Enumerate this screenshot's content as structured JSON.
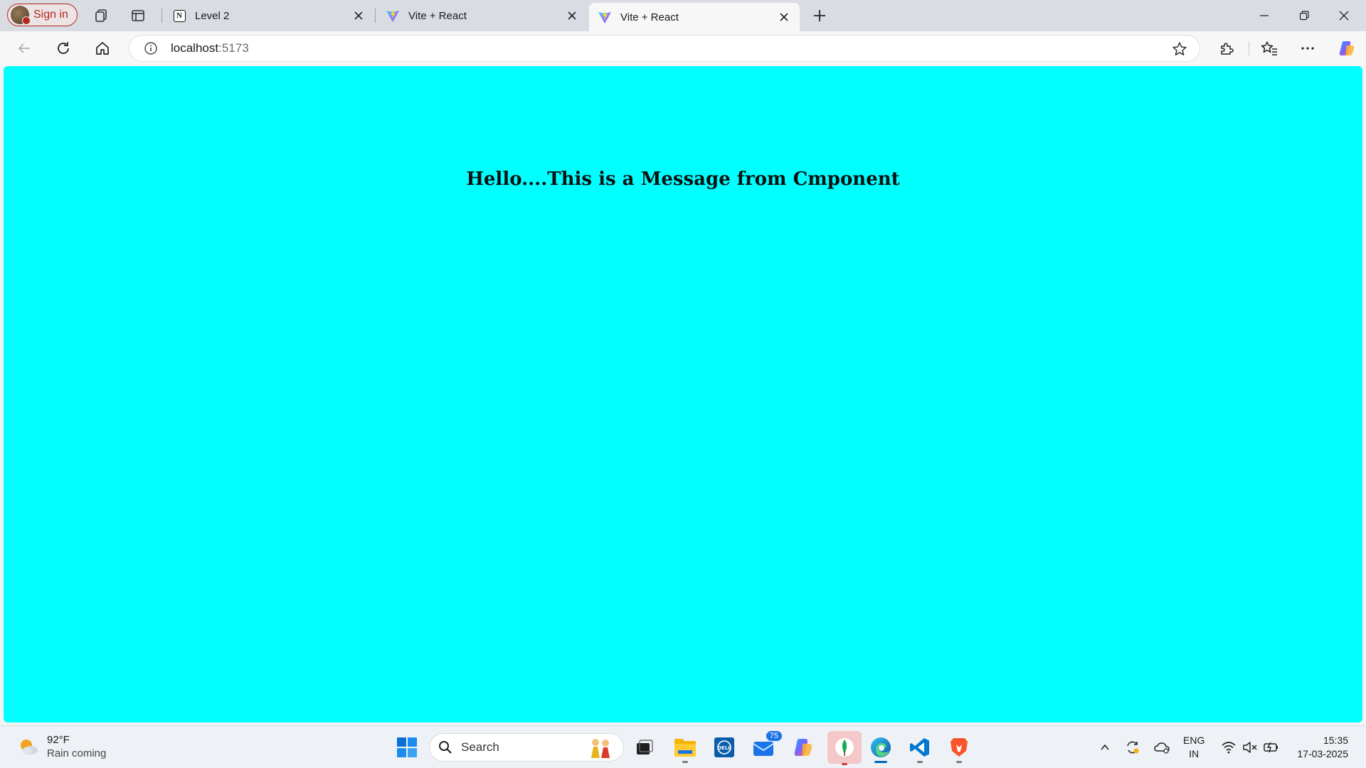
{
  "browser": {
    "profile_label": "Sign in",
    "tabs": [
      {
        "title": "Level 2",
        "icon": "notion-icon"
      },
      {
        "title": "Vite + React",
        "icon": "vite-icon"
      },
      {
        "title": "Vite + React",
        "icon": "vite-icon",
        "active": true
      }
    ],
    "address": {
      "host": "localhost",
      "port": ":5173"
    }
  },
  "page": {
    "background": "#00ffff",
    "message": "Hello....This is a Message from Cmponent"
  },
  "taskbar": {
    "weather": {
      "temp": "92°F",
      "condition": "Rain coming"
    },
    "search_label": "Search",
    "mail_badge": "75",
    "language": {
      "line1": "ENG",
      "line2": "IN"
    },
    "clock": {
      "time": "15:35",
      "date": "17-03-2025"
    }
  }
}
